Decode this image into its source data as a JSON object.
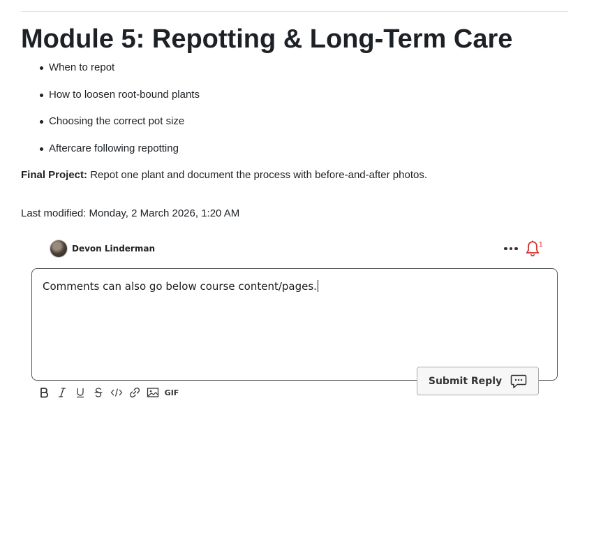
{
  "page": {
    "title": "Module 5: Repotting & Long-Term Care",
    "topics": [
      "When to repot",
      "How to loosen root-bound plants",
      "Choosing the correct pot size",
      "Aftercare following repotting"
    ],
    "final_project": {
      "label": "Final Project:",
      "text": "Repot one plant and document the process with before-and-after photos."
    },
    "last_modified": "Last modified: Monday, 2 March 2026, 1:20 AM"
  },
  "comments": {
    "author": {
      "name": "Devon Linderman",
      "avatar_icon": "avatar-photo"
    },
    "more_icon": "more-options-icon",
    "notification": {
      "icon": "bell-icon",
      "count": "1",
      "color": "#d22b2b"
    },
    "editor": {
      "text": "Comments can also go below course content/pages."
    },
    "submit": {
      "label": "Submit Reply",
      "icon": "chat-bubble-icon"
    },
    "toolbar": {
      "items": [
        "bold-icon",
        "italic-icon",
        "underline-icon",
        "strikethrough-icon",
        "code-icon",
        "link-icon",
        "image-icon"
      ],
      "gif_label": "GIF"
    }
  }
}
